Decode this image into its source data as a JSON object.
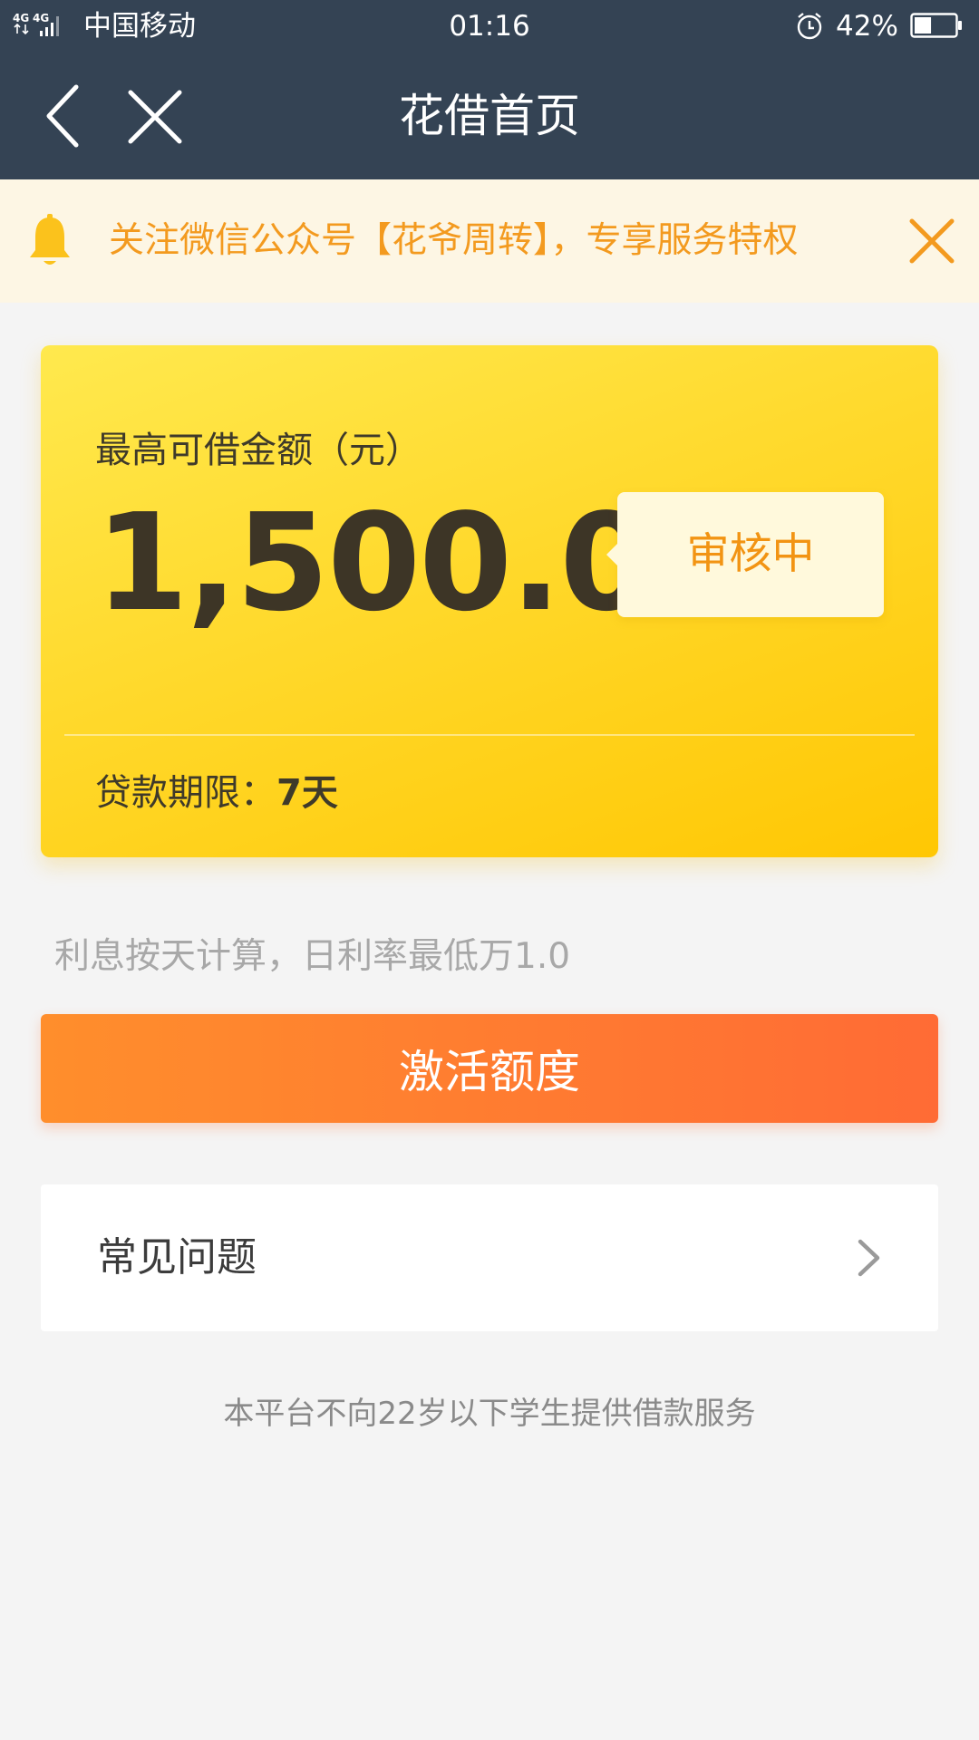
{
  "status_bar": {
    "network": "4G 4G",
    "carrier": "中国移动",
    "time": "01:16",
    "battery": "42%",
    "battery_level": 0.42
  },
  "nav": {
    "title": "花借首页"
  },
  "notice": {
    "text": "关注微信公众号【花爷周转】，专享服务特权"
  },
  "card": {
    "label": "最高可借金额（元）",
    "amount": "1,500.00",
    "status": "审核中",
    "term_label": "贷款期限：",
    "term_value": "7天"
  },
  "interest_hint": "利息按天计算，日利率最低万1.0",
  "activate_button": "激活额度",
  "faq": {
    "label": "常见问题"
  },
  "footer_note": "本平台不向22岁以下学生提供借款服务",
  "colors": {
    "header_bg": "#344354",
    "notice_bg": "#fdf6e4",
    "notice_text": "#f39a1f",
    "card_yellow": "#ffd92c",
    "button_orange": "#ff7a30",
    "page_bg": "#f4f4f4"
  },
  "icons": {
    "signal": "signal-icon",
    "alarm": "alarm-icon",
    "battery": "battery-icon",
    "back": "back-arrow-icon",
    "close": "close-icon",
    "bell": "bell-icon",
    "notice_close": "close-icon",
    "chevron": "chevron-right-icon"
  }
}
